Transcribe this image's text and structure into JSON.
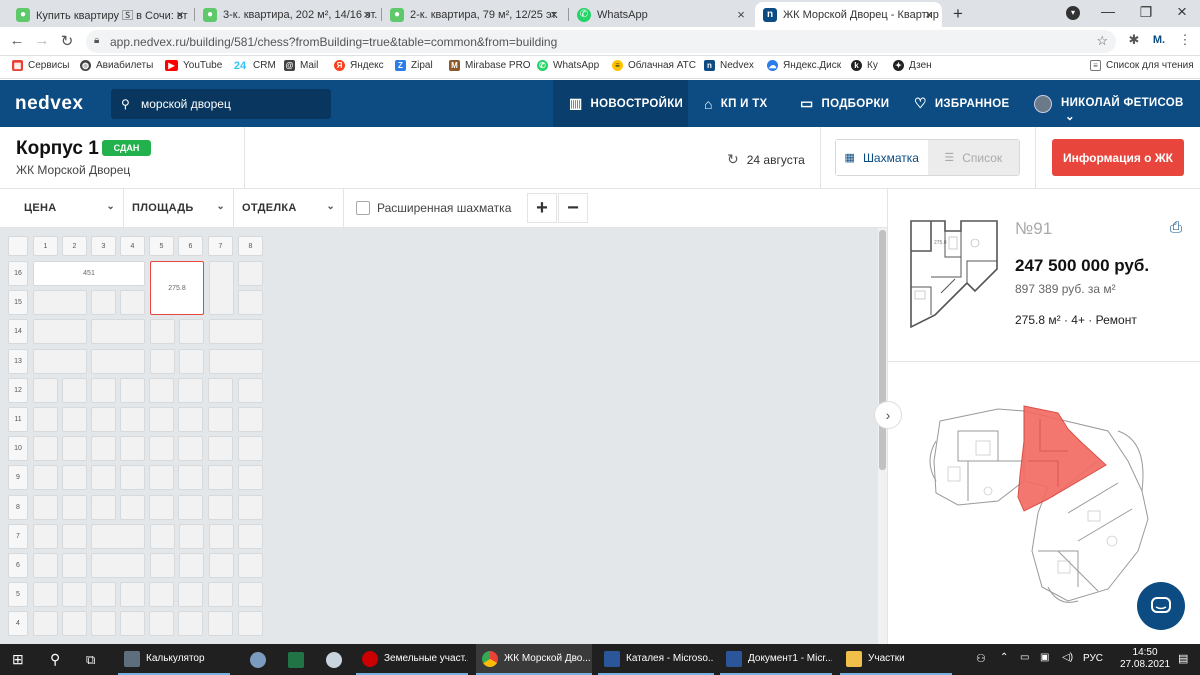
{
  "browser": {
    "tabs": [
      {
        "title": "Купить квартиру 🅂 в Сочи: вт",
        "icon": "avito-icon",
        "color": "#5ec96b"
      },
      {
        "title": "3-к. квартира, 202 м², 14/16 эт.",
        "icon": "avito-icon",
        "color": "#5ec96b"
      },
      {
        "title": "2-к. квартира, 79 м², 12/25 эт.",
        "icon": "avito-icon",
        "color": "#5ec96b"
      },
      {
        "title": "WhatsApp",
        "icon": "whatsapp-icon",
        "color": "#25d366"
      },
      {
        "title": "ЖК Морской Дворец - Квартир",
        "icon": "nedvex-icon",
        "color": "#0c4c83"
      }
    ],
    "new_tab": "+",
    "url": "app.nedvex.ru/building/581/chess?fromBuilding=true&table=common&from=building",
    "profile": "М.",
    "bookmarks": [
      {
        "label": "Сервисы",
        "icon": "apps-icon",
        "color": "#e94235"
      },
      {
        "label": "Авиабилеты",
        "icon": "globe-icon",
        "color": "#444"
      },
      {
        "label": "YouTube",
        "icon": "youtube-icon",
        "color": "#ff0000"
      },
      {
        "label": "CRM",
        "icon": "bitrix-icon",
        "color": "#2fc6f6"
      },
      {
        "label": "Mail",
        "icon": "mail-icon",
        "color": "#444"
      },
      {
        "label": "Яндекс",
        "icon": "yandex-icon",
        "color": "#fc3f1d"
      },
      {
        "label": "Zipal",
        "icon": "zipal-icon",
        "color": "#2b7de9"
      },
      {
        "label": "Mirabase PRO",
        "icon": "mirabase-icon",
        "color": "#8b5a2b"
      },
      {
        "label": "WhatsApp",
        "icon": "whatsapp-icon",
        "color": "#25d366"
      },
      {
        "label": "Облачная АТС",
        "icon": "beeline-icon",
        "color": "#ffc400"
      },
      {
        "label": "Nedvex",
        "icon": "nedvex-icon",
        "color": "#0c4c83"
      },
      {
        "label": "Яндекс.Диск",
        "icon": "yadisk-icon",
        "color": "#2b7de9"
      },
      {
        "label": "Ку",
        "icon": "ku-icon",
        "color": "#222"
      },
      {
        "label": "Дзен",
        "icon": "dzen-icon",
        "color": "#222"
      }
    ],
    "reading_list": "Список для чтения"
  },
  "site": {
    "logo": "nedvex",
    "search_value": "морской дворец",
    "nav": [
      {
        "label": "НОВОСТРОЙКИ",
        "icon": "building-icon",
        "active": true
      },
      {
        "label": "КП И ТХ",
        "icon": "house-icon",
        "active": false
      },
      {
        "label": "ПОДБОРКИ",
        "icon": "folder-icon",
        "active": false
      },
      {
        "label": "ИЗБРАННОЕ",
        "icon": "heart-icon",
        "active": false
      }
    ],
    "user_name": "НИКОЛАЙ ФЕТИСОВ"
  },
  "building": {
    "title": "Корпус 1",
    "status": "СДАН",
    "complex": "ЖК Морской Дворец",
    "date": "24 августа",
    "view_chess": "Шахматка",
    "view_list": "Список",
    "info_button": "Информация о ЖК"
  },
  "filters": {
    "price": "ЦЕНА",
    "area": "ПЛОЩАДЬ",
    "finish": "ОТДЕЛКА",
    "extended_label": "Расширенная шахматка",
    "zoom_in": "+",
    "zoom_out": "−"
  },
  "chess": {
    "risers": [
      "1",
      "2",
      "3",
      "4",
      "5",
      "6",
      "7",
      "8"
    ],
    "floors": [
      "16",
      "15",
      "14",
      "13",
      "12",
      "11",
      "10",
      "9",
      "8",
      "7",
      "6",
      "5",
      "4"
    ],
    "apt_451": "451",
    "apt_selected": "275.8"
  },
  "apartment": {
    "number": "№91",
    "price": "247 500 000 руб.",
    "price_per_m2": "897 389 руб. за м²",
    "specs": "275.8 м² · 4+ · Ремонт",
    "plan_label": "275.8",
    "accent": "#e8453c"
  },
  "taskbar": {
    "apps": [
      {
        "label": "Калькулятор",
        "color": "#5f6e7d"
      },
      {
        "label": "Земельные участ...",
        "color": "#cc0000"
      },
      {
        "label": "ЖК Морской Дво...",
        "color": "#4285f4"
      },
      {
        "label": "Каталея - Microso...",
        "color": "#2b579a"
      },
      {
        "label": "Документ1 - Micr...",
        "color": "#2b579a"
      },
      {
        "label": "Участки",
        "color": "#f0c04a"
      }
    ],
    "lang": "РУС",
    "time": "14:50",
    "date": "27.08.2021"
  }
}
